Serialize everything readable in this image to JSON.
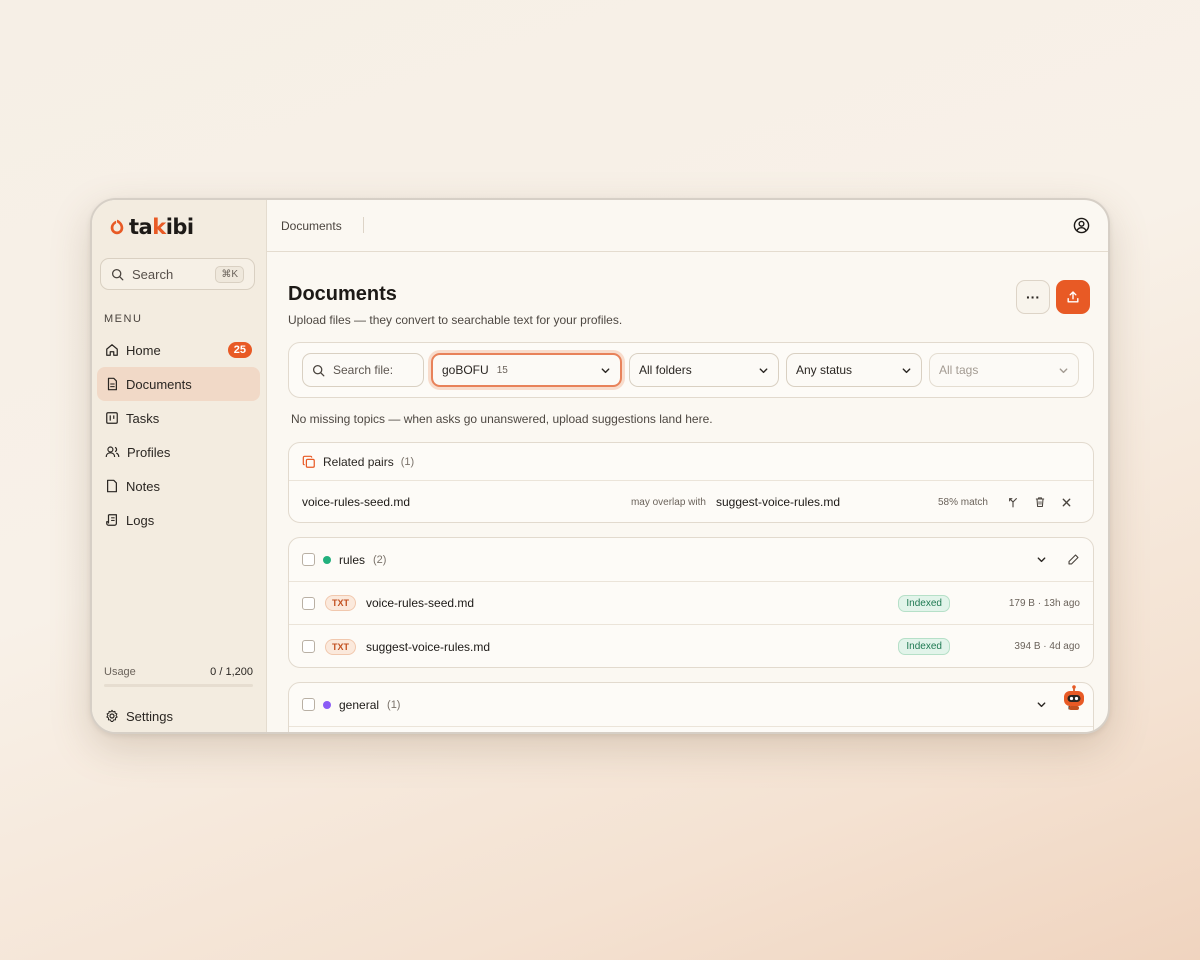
{
  "app": {
    "logo_text_1": "ta",
    "logo_text_accent": "k",
    "logo_text_2": "ibi",
    "brand_color": "#e85a25"
  },
  "sidebar": {
    "search_label": "Search",
    "search_shortcut": "⌘K",
    "menu_heading": "MENU",
    "items": [
      {
        "label": "Home",
        "icon": "home-icon",
        "badge": "25"
      },
      {
        "label": "Documents",
        "icon": "document-icon",
        "active": true
      },
      {
        "label": "Tasks",
        "icon": "kanban-icon"
      },
      {
        "label": "Profiles",
        "icon": "users-icon"
      },
      {
        "label": "Notes",
        "icon": "note-icon"
      },
      {
        "label": "Logs",
        "icon": "scroll-icon"
      }
    ],
    "usage_label": "Usage",
    "usage_value": "0 / 1,200",
    "usage_fraction": 0,
    "settings_label": "Settings"
  },
  "topbar": {
    "breadcrumb": "Documents"
  },
  "page": {
    "title": "Documents",
    "subtitle": "Upload files — they convert to searchable text for your profiles.",
    "more_label": "···"
  },
  "filters": {
    "search_placeholder": "Search file:",
    "profile_value": "goBOFU",
    "profile_count": "15",
    "folder_value": "All folders",
    "status_value": "Any status",
    "tags_placeholder": "All tags"
  },
  "notice": "No missing topics — when asks go unanswered, upload suggestions land here.",
  "related_pairs": {
    "title": "Related pairs",
    "count": "(1)",
    "rows": [
      {
        "left": "voice-rules-seed.md",
        "overlap_label": "may overlap with",
        "right": "suggest-voice-rules.md",
        "match": "58% match"
      }
    ]
  },
  "groups": [
    {
      "name": "rules",
      "count": "(2)",
      "color": "#22b07d",
      "files": [
        {
          "type": "TXT",
          "name": "voice-rules-seed.md",
          "status": "Indexed",
          "meta": "179 B · 13h ago"
        },
        {
          "type": "TXT",
          "name": "suggest-voice-rules.md",
          "status": "Indexed",
          "meta": "394 B · 4d ago"
        }
      ]
    },
    {
      "name": "general",
      "count": "(1)",
      "color": "#8b5cf6",
      "files": []
    }
  ]
}
